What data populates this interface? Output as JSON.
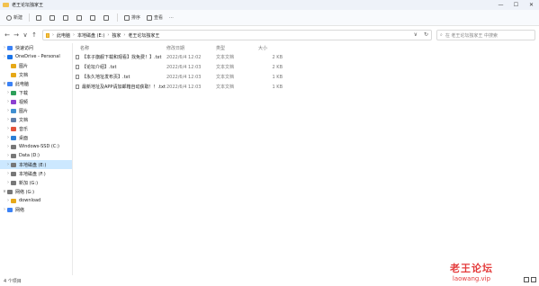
{
  "window": {
    "title": "老王论坛独家王",
    "controls": [
      "—",
      "☐",
      "✕"
    ]
  },
  "toolbar": {
    "new_label": "新建",
    "sort_label": "排序",
    "view_label": "查看",
    "more_label": "···"
  },
  "nav": {
    "back": "←",
    "forward": "→",
    "up_history": "∨",
    "up": "↑",
    "breadcrumbs": [
      "此电脑",
      "本地磁盘 (E:)",
      "独家",
      "老王论坛独家王"
    ],
    "refresh": "↻",
    "dropdown": "∨"
  },
  "search": {
    "placeholder": "在 老王论坛独家王 中搜索"
  },
  "sidebar": {
    "items": [
      {
        "label": "快速访问",
        "chev": "›",
        "color": "#3b82f6",
        "indent": 0
      },
      {
        "label": "OneDrive - Personal",
        "chev": "›",
        "color": "#1a73e8",
        "indent": 0
      },
      {
        "label": "图片",
        "chev": "",
        "color": "#e6a817",
        "indent": 1
      },
      {
        "label": "文档",
        "chev": "",
        "color": "#e6a817",
        "indent": 1
      },
      {
        "label": "此电脑",
        "chev": "∨",
        "color": "#3b82f6",
        "indent": 0
      },
      {
        "label": "下载",
        "chev": "›",
        "color": "#2e9f5a",
        "indent": 1
      },
      {
        "label": "视频",
        "chev": "›",
        "color": "#8b3fd1",
        "indent": 1
      },
      {
        "label": "图片",
        "chev": "›",
        "color": "#3f8fd1",
        "indent": 1
      },
      {
        "label": "文档",
        "chev": "›",
        "color": "#5f7ea8",
        "indent": 1
      },
      {
        "label": "音乐",
        "chev": "›",
        "color": "#e2533b",
        "indent": 1
      },
      {
        "label": "桌面",
        "chev": "›",
        "color": "#2b7fd6",
        "indent": 1
      },
      {
        "label": "Windows-SSD (C:)",
        "chev": "›",
        "color": "#777777",
        "indent": 1
      },
      {
        "label": "Data (D:)",
        "chev": "›",
        "color": "#777777",
        "indent": 1
      },
      {
        "label": "本地磁盘 (E:)",
        "chev": "›",
        "color": "#777777",
        "indent": 1,
        "selected": true
      },
      {
        "label": "本地磁盘 (F:)",
        "chev": "›",
        "color": "#777777",
        "indent": 1
      },
      {
        "label": "新加 (G:)",
        "chev": "›",
        "color": "#777777",
        "indent": 1
      },
      {
        "label": "网络 (G:)",
        "chev": "∨",
        "color": "#777777",
        "indent": 0
      },
      {
        "label": "download",
        "chev": "›",
        "color": "#e6a817",
        "indent": 1
      },
      {
        "label": "网络",
        "chev": "›",
        "color": "#3b82f6",
        "indent": 0
      }
    ]
  },
  "files": {
    "columns": {
      "name": "名称",
      "date": "修改日期",
      "type": "类型",
      "size": "大小"
    },
    "rows": [
      {
        "name": "【本子旗舰下载和观看】找免费！】.txt",
        "date": "2022/6/4 12:02",
        "type": "文本文档",
        "size": "2 KB"
      },
      {
        "name": "【论坛介绍】.txt",
        "date": "2022/6/4 12:03",
        "type": "文本文档",
        "size": "2 KB"
      },
      {
        "name": "【永久地址发布页】.txt",
        "date": "2022/6/4 12:03",
        "type": "文本文档",
        "size": "1 KB"
      },
      {
        "name": "最新地址及APP请加邮箱自动获取！！.txt",
        "date": "2022/6/4 12:03",
        "type": "文本文档",
        "size": "1 KB"
      }
    ]
  },
  "status": {
    "count": "4 个项目"
  },
  "watermark": {
    "line1": "老王论坛",
    "line2": "laowang.vip"
  }
}
